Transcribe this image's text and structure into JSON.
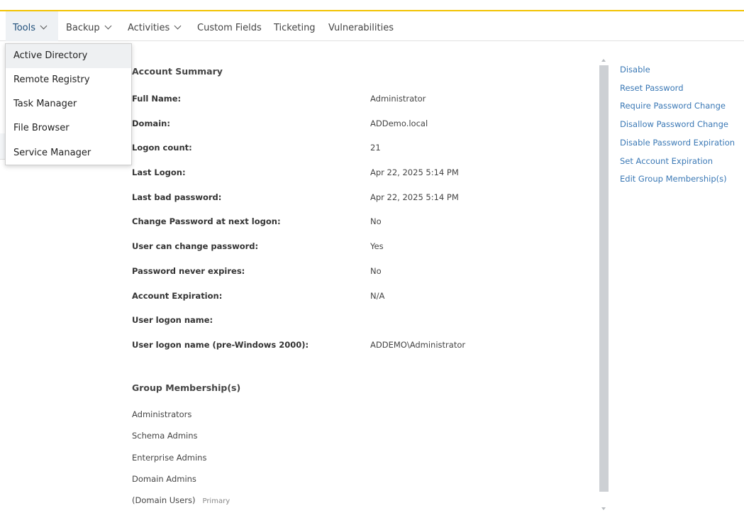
{
  "nav": {
    "tools": "Tools",
    "backup": "Backup",
    "activities": "Activities",
    "custom_fields": "Custom Fields",
    "ticketing": "Ticketing",
    "vulnerabilities": "Vulnerabilities"
  },
  "tools_menu": [
    "Active Directory",
    "Remote Registry",
    "Task Manager",
    "File Browser",
    "Service Manager"
  ],
  "account_summary": {
    "title": "Account Summary",
    "rows": [
      {
        "label": "Full Name:",
        "value": "Administrator"
      },
      {
        "label": "Domain:",
        "value": "ADDemo.local"
      },
      {
        "label": "Logon count:",
        "value": "21"
      },
      {
        "label": "Last Logon:",
        "value": "Apr 22, 2025 5:14 PM"
      },
      {
        "label": "Last bad password:",
        "value": "Apr 22, 2025 5:14 PM"
      },
      {
        "label": "Change Password at next logon:",
        "value": "No"
      },
      {
        "label": "User can change password:",
        "value": "Yes"
      },
      {
        "label": "Password never expires:",
        "value": "No"
      },
      {
        "label": "Account Expiration:",
        "value": "N/A"
      },
      {
        "label": "User logon name:",
        "value": ""
      },
      {
        "label": "User logon name (pre-Windows 2000):",
        "value": "ADDEMO\\Administrator"
      }
    ]
  },
  "group_membership": {
    "title": "Group Membership(s)",
    "groups": [
      "Administrators",
      "Schema Admins",
      "Enterprise Admins",
      "Domain Admins",
      "(Domain Users)"
    ],
    "primary_badge": "Primary"
  },
  "actions": [
    "Disable",
    "Reset Password",
    "Require Password Change",
    "Disallow Password Change",
    "Disable Password Expiration",
    "Set Account Expiration",
    "Edit Group Membership(s)"
  ],
  "colors": {
    "accent": "#f2c200",
    "link": "#3a78b5"
  }
}
